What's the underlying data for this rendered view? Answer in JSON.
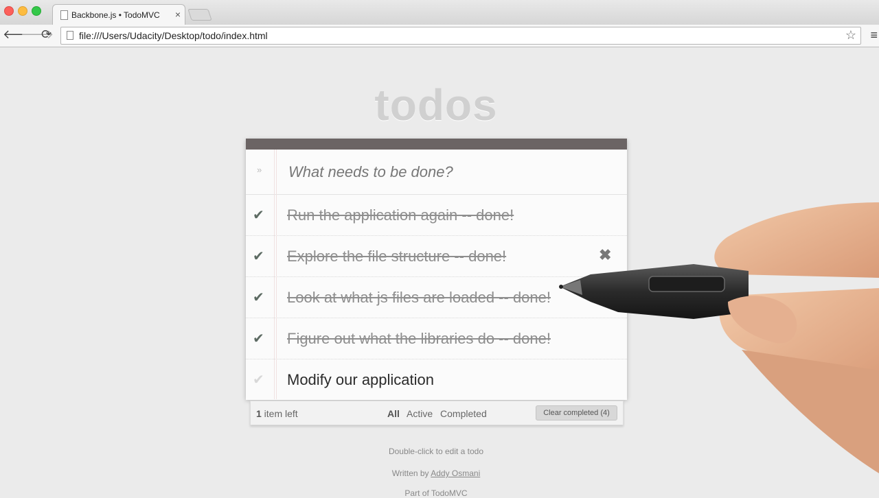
{
  "browser": {
    "tab_title": "Backbone.js • TodoMVC",
    "tab_close": "×",
    "url": "file:///Users/Udacity/Desktop/todo/index.html",
    "back": "🡐",
    "forward": "🡒",
    "reload": "⟳",
    "star": "☆",
    "menu": "≡"
  },
  "app": {
    "title": "todos",
    "new_todo_placeholder": "What needs to be done?",
    "toggle_all_glyph": "»",
    "todos": [
      {
        "label": "Run the application again -- done!",
        "completed": true
      },
      {
        "label": "Explore the file structure -- done!",
        "completed": true
      },
      {
        "label": "Look at what js files are loaded -- done!",
        "completed": true
      },
      {
        "label": "Figure out what the libraries do -- done!",
        "completed": true
      },
      {
        "label": "Modify our application",
        "completed": false
      }
    ],
    "check_glyph": "✔",
    "destroy_glyph": "✖",
    "footer": {
      "count": "1",
      "count_suffix": " item left",
      "filters": [
        "All",
        "Active",
        "Completed"
      ],
      "selected_filter": "All",
      "clear_completed": "Clear completed (4)"
    }
  },
  "info": {
    "edit_hint": "Double-click to edit a todo",
    "written_by": "Written by ",
    "author": "Addy Osmani",
    "part_of": "Part of TodoMVC"
  },
  "colors": {
    "header_bar": "#6b6464",
    "check_done": "#5d6b63",
    "check_off": "#d8d8d8"
  }
}
